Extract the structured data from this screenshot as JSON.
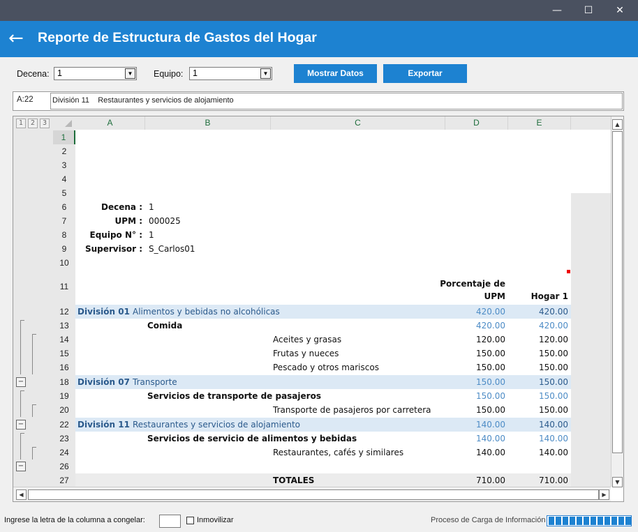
{
  "window": {
    "controls": {
      "minimize": "—",
      "maximize": "☐",
      "close": "✕"
    }
  },
  "header": {
    "back_icon": "left-arrow-icon",
    "back_glyph": "←",
    "title": "Reporte de Estructura de Gastos del Hogar"
  },
  "toolbar": {
    "decena_label": "Decena:",
    "decena_value": "1",
    "equipo_label": "Equipo:",
    "equipo_value": "1",
    "mostrar_label": "Mostrar Datos",
    "exportar_label": "Exportar"
  },
  "formula_bar": {
    "cell_ref": "A:22",
    "content": "División 11    Restaurantes y servicios de alojamiento"
  },
  "sheet": {
    "outline_levels": [
      "1",
      "2",
      "3"
    ],
    "columns": [
      "A",
      "B",
      "C",
      "D",
      "E"
    ],
    "info": {
      "decena_label": "Decena :",
      "decena_value": "1",
      "upm_label": "UPM :",
      "upm_value": "000025",
      "equipo_label": "Equipo N° :",
      "equipo_value": "1",
      "supervisor_label": "Supervisor :",
      "supervisor_value": "S_Carlos01"
    },
    "headers": {
      "col_d_line1": "Porcentaje de",
      "col_d_line2": "UPM",
      "col_e": "Hogar 1"
    },
    "rows": [
      {
        "num": "12",
        "a": "División 01",
        "b": "Alimentos y bebidas no alcohólicas",
        "d": "420.00",
        "e": "420.00"
      },
      {
        "num": "13",
        "b": "Comida",
        "d": "420.00",
        "e": "420.00"
      },
      {
        "num": "14",
        "c": "Aceites y grasas",
        "d": "120.00",
        "e": "120.00"
      },
      {
        "num": "15",
        "c": "Frutas y nueces",
        "d": "150.00",
        "e": "150.00"
      },
      {
        "num": "16",
        "c": "Pescado y otros mariscos",
        "d": "150.00",
        "e": "150.00"
      },
      {
        "num": "18",
        "a": "División 07",
        "b": "Transporte",
        "d": "150.00",
        "e": "150.00"
      },
      {
        "num": "19",
        "b": "Servicios de transporte de pasajeros",
        "d": "150.00",
        "e": "150.00"
      },
      {
        "num": "20",
        "c": "Transporte de pasajeros por carretera",
        "d": "150.00",
        "e": "150.00"
      },
      {
        "num": "22",
        "a": "División 11",
        "b": "Restaurantes y servicios de alojamiento",
        "d": "140.00",
        "e": "140.00"
      },
      {
        "num": "23",
        "b": "Servicios de servicio de alimentos y bebidas",
        "d": "140.00",
        "e": "140.00"
      },
      {
        "num": "24",
        "c": "Restaurantes, cafés y similares",
        "d": "140.00",
        "e": "140.00"
      },
      {
        "num": "26"
      },
      {
        "num": "27",
        "c": "TOTALES",
        "d": "710.00",
        "e": "710.00"
      }
    ],
    "row_numbers_top": [
      "1",
      "2",
      "3",
      "4",
      "5",
      "6",
      "7",
      "8",
      "9",
      "10",
      "11"
    ]
  },
  "footer": {
    "freeze_label": "Ingrese la letra de la columna a congelar:",
    "freeze_value": "",
    "inmovilizar_label": "Inmovilizar",
    "progress_label": "Proceso de Carga de Información",
    "progress_fraction": 1.0
  },
  "colors": {
    "accent": "#1d82d1",
    "titlebar": "#4a5160",
    "band": "#dce9f5"
  }
}
